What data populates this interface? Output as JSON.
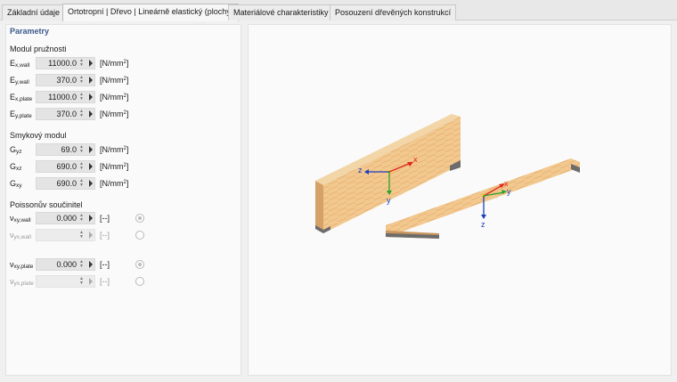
{
  "tabs": [
    {
      "label": "Základní údaje",
      "active": false
    },
    {
      "label": "Ortotropní | Dřevo | Lineárně elastický (plochy)",
      "active": true
    },
    {
      "label": "Materiálové charakteristiky",
      "active": false
    },
    {
      "label": "Posouzení dřevěných konstrukcí",
      "active": false
    }
  ],
  "section_title": "Parametry",
  "modulus_group": {
    "title": "Modul pružnosti",
    "rows": [
      {
        "symbol": "E",
        "sub": "x,wall",
        "value": "11000.0",
        "unit": "[N/mm",
        "unit_sup": "2",
        "unit_end": "]"
      },
      {
        "symbol": "E",
        "sub": "y,wall",
        "value": "370.0",
        "unit": "[N/mm",
        "unit_sup": "2",
        "unit_end": "]"
      },
      {
        "symbol": "E",
        "sub": "x,plate",
        "value": "11000.0",
        "unit": "[N/mm",
        "unit_sup": "2",
        "unit_end": "]"
      },
      {
        "symbol": "E",
        "sub": "y,plate",
        "value": "370.0",
        "unit": "[N/mm",
        "unit_sup": "2",
        "unit_end": "]"
      }
    ]
  },
  "shear_group": {
    "title": "Smykový modul",
    "rows": [
      {
        "symbol": "G",
        "sub": "yz",
        "value": "69.0",
        "unit": "[N/mm",
        "unit_sup": "2",
        "unit_end": "]"
      },
      {
        "symbol": "G",
        "sub": "xz",
        "value": "690.0",
        "unit": "[N/mm",
        "unit_sup": "2",
        "unit_end": "]"
      },
      {
        "symbol": "G",
        "sub": "xy",
        "value": "690.0",
        "unit": "[N/mm",
        "unit_sup": "2",
        "unit_end": "]"
      }
    ]
  },
  "poisson_group": {
    "title": "Poissonův součinitel",
    "rows": [
      {
        "symbol": "ν",
        "sub": "xy,wall",
        "value": "0.000",
        "unit": "[--]",
        "enabled": true,
        "radio_checked": true
      },
      {
        "symbol": "ν",
        "sub": "yx,wall",
        "value": "",
        "unit": "[--]",
        "enabled": false,
        "radio_checked": false
      },
      {
        "symbol": "ν",
        "sub": "xy,plate",
        "value": "0.000",
        "unit": "[--]",
        "enabled": true,
        "radio_checked": true
      },
      {
        "symbol": "ν",
        "sub": "yx,plate",
        "value": "",
        "unit": "[--]",
        "enabled": false,
        "radio_checked": false
      }
    ]
  },
  "viewer": {
    "wall_axes": {
      "x": "x",
      "y": "y",
      "z": "z"
    },
    "plate_axes": {
      "x": "x",
      "y": "y",
      "z": "z"
    },
    "colors": {
      "wood_light": "#f4cf9c",
      "wood_mid": "#e9b577",
      "wood_edge": "#c9965d",
      "support": "#6c6c6c",
      "axis_x": "#e0281b",
      "axis_y": "#2aa32a",
      "axis_z": "#1d3fbf",
      "accent_title": "#3a5a88"
    }
  }
}
